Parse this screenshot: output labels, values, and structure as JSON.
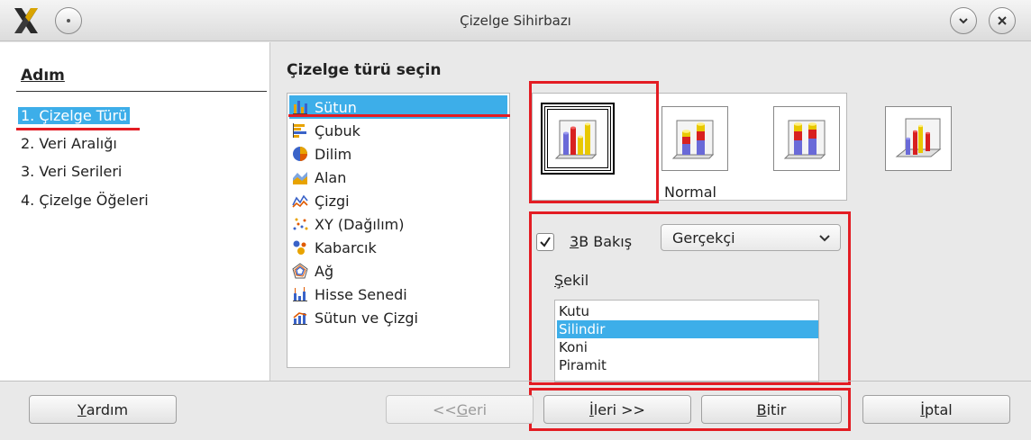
{
  "window": {
    "title": "Çizelge Sihirbazı"
  },
  "steps": {
    "heading": "Adım",
    "items": [
      "1. Çizelge Türü",
      "2. Veri Aralığı",
      "3. Veri Serileri",
      "4. Çizelge Öğeleri"
    ]
  },
  "main": {
    "heading": "Çizelge türü seçin"
  },
  "chart_types": [
    {
      "label": "Sütun",
      "icon": "column-chart-icon"
    },
    {
      "label": "Çubuk",
      "icon": "bar-chart-icon"
    },
    {
      "label": "Dilim",
      "icon": "pie-chart-icon"
    },
    {
      "label": "Alan",
      "icon": "area-chart-icon"
    },
    {
      "label": "Çizgi",
      "icon": "line-chart-icon"
    },
    {
      "label": "XY (Dağılım)",
      "icon": "scatter-chart-icon"
    },
    {
      "label": "Kabarcık",
      "icon": "bubble-chart-icon"
    },
    {
      "label": "Ağ",
      "icon": "net-chart-icon"
    },
    {
      "label": "Hisse Senedi",
      "icon": "stock-chart-icon"
    },
    {
      "label": "Sütun ve Çizgi",
      "icon": "column-line-chart-icon"
    }
  ],
  "variant_caption": "Normal",
  "options": {
    "view3d_prefix": "",
    "view3d_mnemonic": "3",
    "view3d_rest": "B Bakış",
    "view3d_checked": true,
    "scheme": "Gerçekçi",
    "shape_label_mnemonic": "Ş",
    "shape_label_rest": "ekil",
    "shapes": [
      "Kutu",
      "Silindir",
      "Koni",
      "Piramit"
    ],
    "selected_shape": "Silindir"
  },
  "buttons": {
    "help_m": "Y",
    "help_r": "ardım",
    "back_pre": "<< ",
    "back_m": "G",
    "back_r": "eri",
    "next_m": "İ",
    "next_r": "leri >>",
    "finish_m": "B",
    "finish_r": "itir",
    "cancel_m": "İ",
    "cancel_r": "ptal"
  },
  "colors": {
    "selection": "#3daee9",
    "highlight": "#e31c23"
  }
}
